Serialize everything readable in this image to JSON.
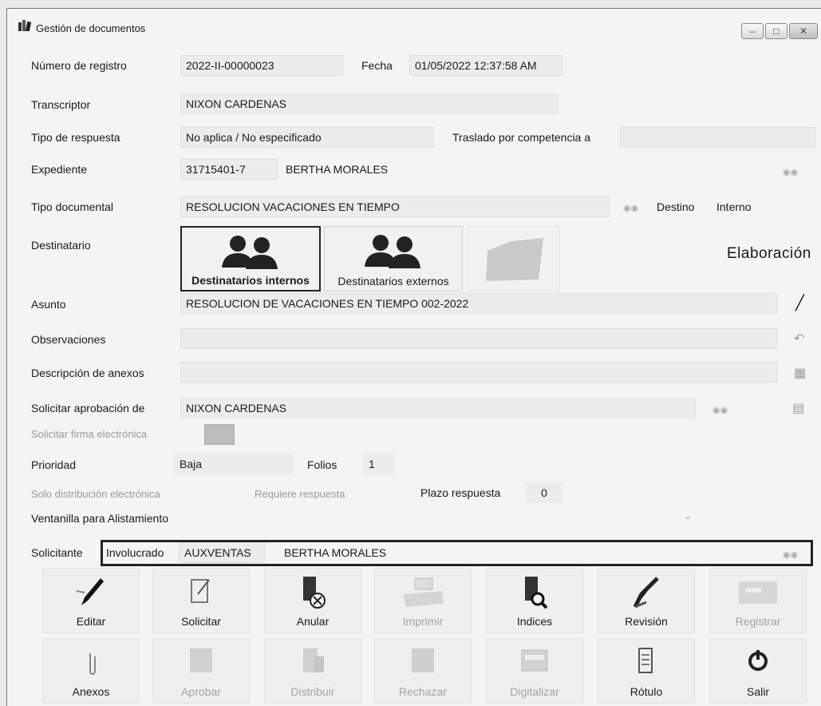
{
  "window": {
    "title": "Gestión de documentos"
  },
  "form": {
    "numero_registro": {
      "label": "Número de registro",
      "value": "2022-II-00000023"
    },
    "fecha": {
      "label": "Fecha",
      "value": "01/05/2022 12:37:58 AM"
    },
    "transcriptor": {
      "label": "Transcriptor",
      "value": "NIXON CARDENAS"
    },
    "tipo_respuesta": {
      "label": "Tipo de respuesta",
      "value": "No aplica / No especificado"
    },
    "traslado": {
      "label": "Traslado por competencia a",
      "value": ""
    },
    "expediente": {
      "label": "Expediente",
      "code": "31715401-7",
      "name": "BERTHA MORALES"
    },
    "tipo_documental": {
      "label": "Tipo documental",
      "value": "RESOLUCION VACACIONES EN TIEMPO"
    },
    "destino": {
      "label": "Destino",
      "value": "Interno"
    },
    "destinatario": {
      "label": "Destinatario",
      "internos": "Destinatarios internos",
      "externos": "Destinatarios externos"
    },
    "estado": "Elaboración",
    "asunto": {
      "label": "Asunto",
      "value": "RESOLUCION DE VACACIONES EN TIEMPO 002-2022"
    },
    "observaciones": {
      "label": "Observaciones",
      "value": ""
    },
    "descripcion_anexos": {
      "label": "Descripción de anexos",
      "value": ""
    },
    "solicitar_aprobacion": {
      "label": "Solicitar aprobación de",
      "value": "NIXON CARDENAS"
    },
    "firma_electronica": {
      "label": "Solicitar firma electrónica"
    },
    "prioridad": {
      "label": "Prioridad",
      "value": "Baja"
    },
    "folios": {
      "label": "Folios",
      "value": "1"
    },
    "solo_distribucion": {
      "label": "Solo distribución electrónica"
    },
    "requiere_respuesta": {
      "label": "Requiere respuesta"
    },
    "plazo_respuesta": {
      "label": "Plazo respuesta",
      "value": "0"
    },
    "ventanilla": {
      "label": "Ventanilla para Alistamiento"
    },
    "solicitante": {
      "label": "Solicitante",
      "tipo": "Involucrado",
      "code": "AUXVENTAS",
      "name": "BERTHA MORALES"
    }
  },
  "toolbar_row1": [
    "Editar",
    "Solicitar",
    "Anular",
    "Imprimir",
    "Indices",
    "Revisión",
    "Registrar"
  ],
  "toolbar_row2": [
    "Anexos",
    "Aprobar",
    "Distribuir",
    "Rechazar",
    "Digitalizar",
    "Rótulo",
    "Salir"
  ],
  "icons": {
    "title": "books-icon",
    "binoculars": "binoculars-icon",
    "edit": "pencil-icon",
    "undo": "undo-icon",
    "calendar": "calendar-icon",
    "sign": "signature-icon",
    "chevron": "chevron-down-icon"
  }
}
